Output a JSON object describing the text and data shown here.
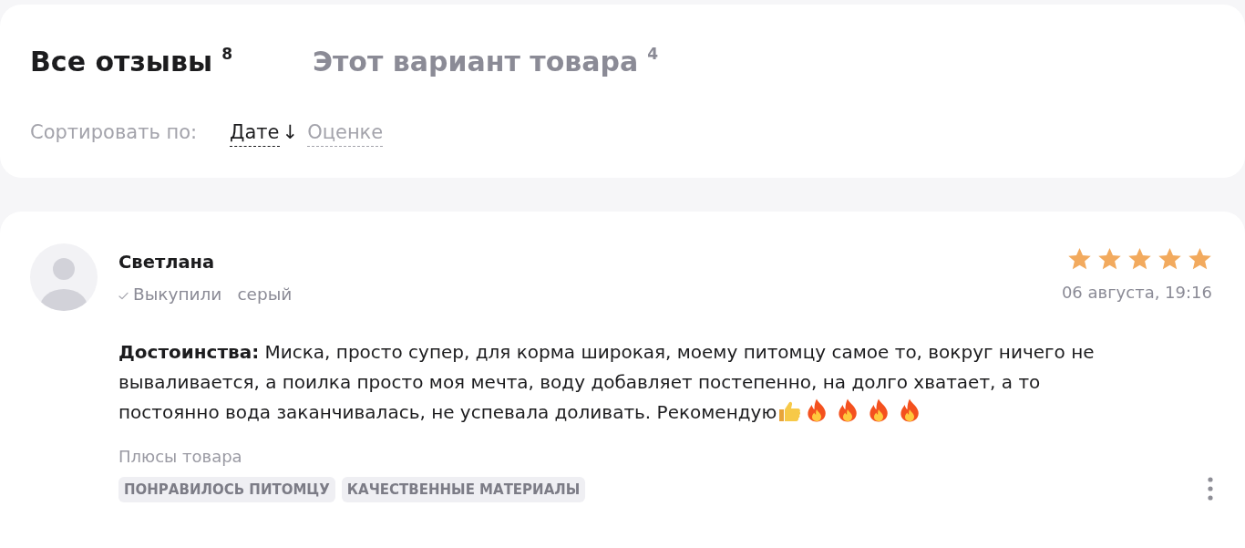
{
  "tabs": [
    {
      "label": "Все отзывы",
      "count": "8",
      "selected": true
    },
    {
      "label": "Этот вариант товара",
      "count": "4",
      "selected": false
    }
  ],
  "sort": {
    "label": "Сортировать по:",
    "options": [
      {
        "label": "Дате",
        "arrow": "↓",
        "selected": true
      },
      {
        "label": "Оценке",
        "selected": false
      }
    ]
  },
  "review": {
    "author": "Светлана",
    "badge": "Выкупили",
    "variant": "серый",
    "stars": 5,
    "date": "06 августа, 19:16",
    "text": "**Достоинства:** Миска, просто супер, для корма широкая, моему питомцу самое то, вокруг ничего не вываливается, а поилка просто моя мечта, воду добавляет постепенно, на долго хватает, а то постоянно вода заканчивалась, не успевала доливать. Рекомендую",
    "emojis": [
      {
        "kind": "thumbs_up"
      },
      {
        "kind": "fire"
      },
      {
        "kind": "fire"
      },
      {
        "kind": "fire"
      },
      {
        "kind": "fire"
      }
    ],
    "pros_title": "Плюсы товара",
    "tags": [
      "ПОНРАВИЛОСЬ ПИТОМЦУ",
      "КАЧЕСТВЕННЫЕ МАТЕРИАЛЫ"
    ]
  }
}
